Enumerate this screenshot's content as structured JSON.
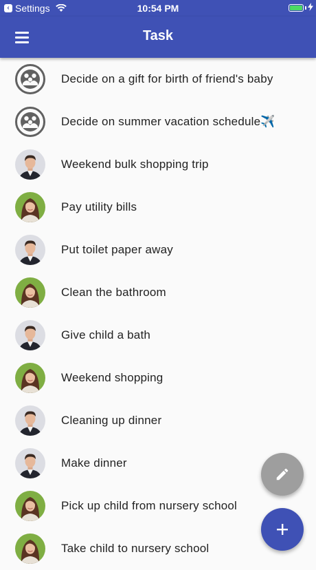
{
  "status": {
    "back_app": "Settings",
    "time": "10:54 PM",
    "battery_color": "#4cd964"
  },
  "appbar": {
    "title": "Task",
    "color": "#3f51b5"
  },
  "tasks": [
    {
      "title": "Decide on a gift for birth of friend's baby",
      "avatar": "group-icon"
    },
    {
      "title": "Decide on summer vacation schedule✈️",
      "avatar": "group-icon"
    },
    {
      "title": "Weekend bulk shopping trip",
      "avatar": "man-avatar"
    },
    {
      "title": "Pay utility bills",
      "avatar": "woman-avatar"
    },
    {
      "title": "Put toilet paper away",
      "avatar": "man-avatar"
    },
    {
      "title": "Clean the bathroom",
      "avatar": "woman-avatar"
    },
    {
      "title": "Give child a bath",
      "avatar": "man-avatar"
    },
    {
      "title": "Weekend shopping",
      "avatar": "woman-avatar"
    },
    {
      "title": "Cleaning up dinner",
      "avatar": "man-avatar"
    },
    {
      "title": "Make dinner",
      "avatar": "man-avatar"
    },
    {
      "title": "Pick up child from nursery school",
      "avatar": "woman-avatar"
    },
    {
      "title": "Take child to nursery school",
      "avatar": "woman-avatar"
    }
  ],
  "fabs": {
    "edit_icon": "pencil-icon",
    "edit_color": "#9e9e9e",
    "add_icon": "plus-icon",
    "add_color": "#3f51b5"
  }
}
